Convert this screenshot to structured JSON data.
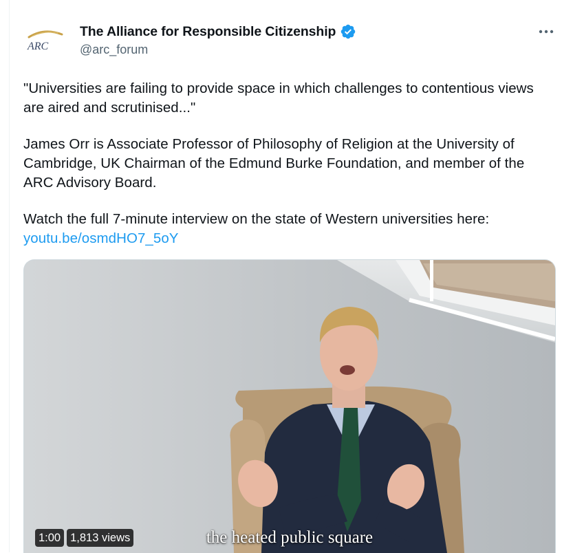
{
  "account": {
    "display_name": "The Alliance for Responsible Citizenship",
    "handle": "@arc_forum",
    "avatar_text": "ARC",
    "verified_color": "#1d9bf0"
  },
  "tweet": {
    "para1": "\"Universities are failing to provide space in which challenges to contentious views are aired and scrutinised...\"",
    "para2": "James Orr is Associate Professor of Philosophy of Religion at the University of Cambridge, UK Chairman of the Edmund Burke Foundation, and member of the ARC Advisory Board.",
    "para3_text": "Watch the full 7-minute interview on the state of Western universities here: ",
    "link_text": "youtu.be/osmdHO7_5oY"
  },
  "video": {
    "duration": "1:00",
    "views": "1,813 views",
    "caption": "the heated public square"
  },
  "icons": {
    "more": "more-horizontal-icon",
    "verified": "verified-badge-icon"
  }
}
